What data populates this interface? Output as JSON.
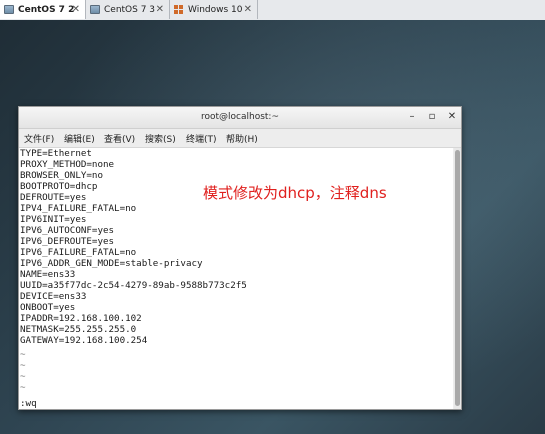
{
  "tabs": [
    {
      "label": "CentOS 7 2",
      "active": true,
      "close": "✕",
      "icon": "vm-icon"
    },
    {
      "label": "CentOS 7 3",
      "active": false,
      "close": "✕",
      "icon": "vm-icon"
    },
    {
      "label": "Windows 10",
      "active": false,
      "close": "✕",
      "icon": "windows-icon"
    }
  ],
  "window": {
    "title": "root@localhost:~",
    "minimize": "–",
    "maximize": "▫",
    "close": "✕"
  },
  "menu": [
    "文件(F)",
    "编辑(E)",
    "查看(V)",
    "搜索(S)",
    "终端(T)",
    "帮助(H)"
  ],
  "terminal": {
    "lines": [
      "TYPE=Ethernet",
      "PROXY_METHOD=none",
      "BROWSER_ONLY=no",
      "BOOTPROTO=dhcp",
      "DEFROUTE=yes",
      "IPV4_FAILURE_FATAL=no",
      "IPV6INIT=yes",
      "IPV6_AUTOCONF=yes",
      "IPV6_DEFROUTE=yes",
      "IPV6_FAILURE_FATAL=no",
      "IPV6_ADDR_GEN_MODE=stable-privacy",
      "NAME=ens33",
      "UUID=a35f77dc-2c54-4279-89ab-9588b773c2f5",
      "DEVICE=ens33",
      "ONBOOT=yes",
      "IPADDR=192.168.100.102",
      "NETMASK=255.255.255.0",
      "GATEWAY=192.168.100.254",
      "~",
      "~",
      "~",
      "~",
      "~"
    ],
    "command": ":wq"
  },
  "annotation": "模式修改为dhcp，注释dns",
  "colors": {
    "annotation": "#e0201e",
    "terminal_bg": "#ffffff",
    "window_chrome": "#ededed"
  }
}
